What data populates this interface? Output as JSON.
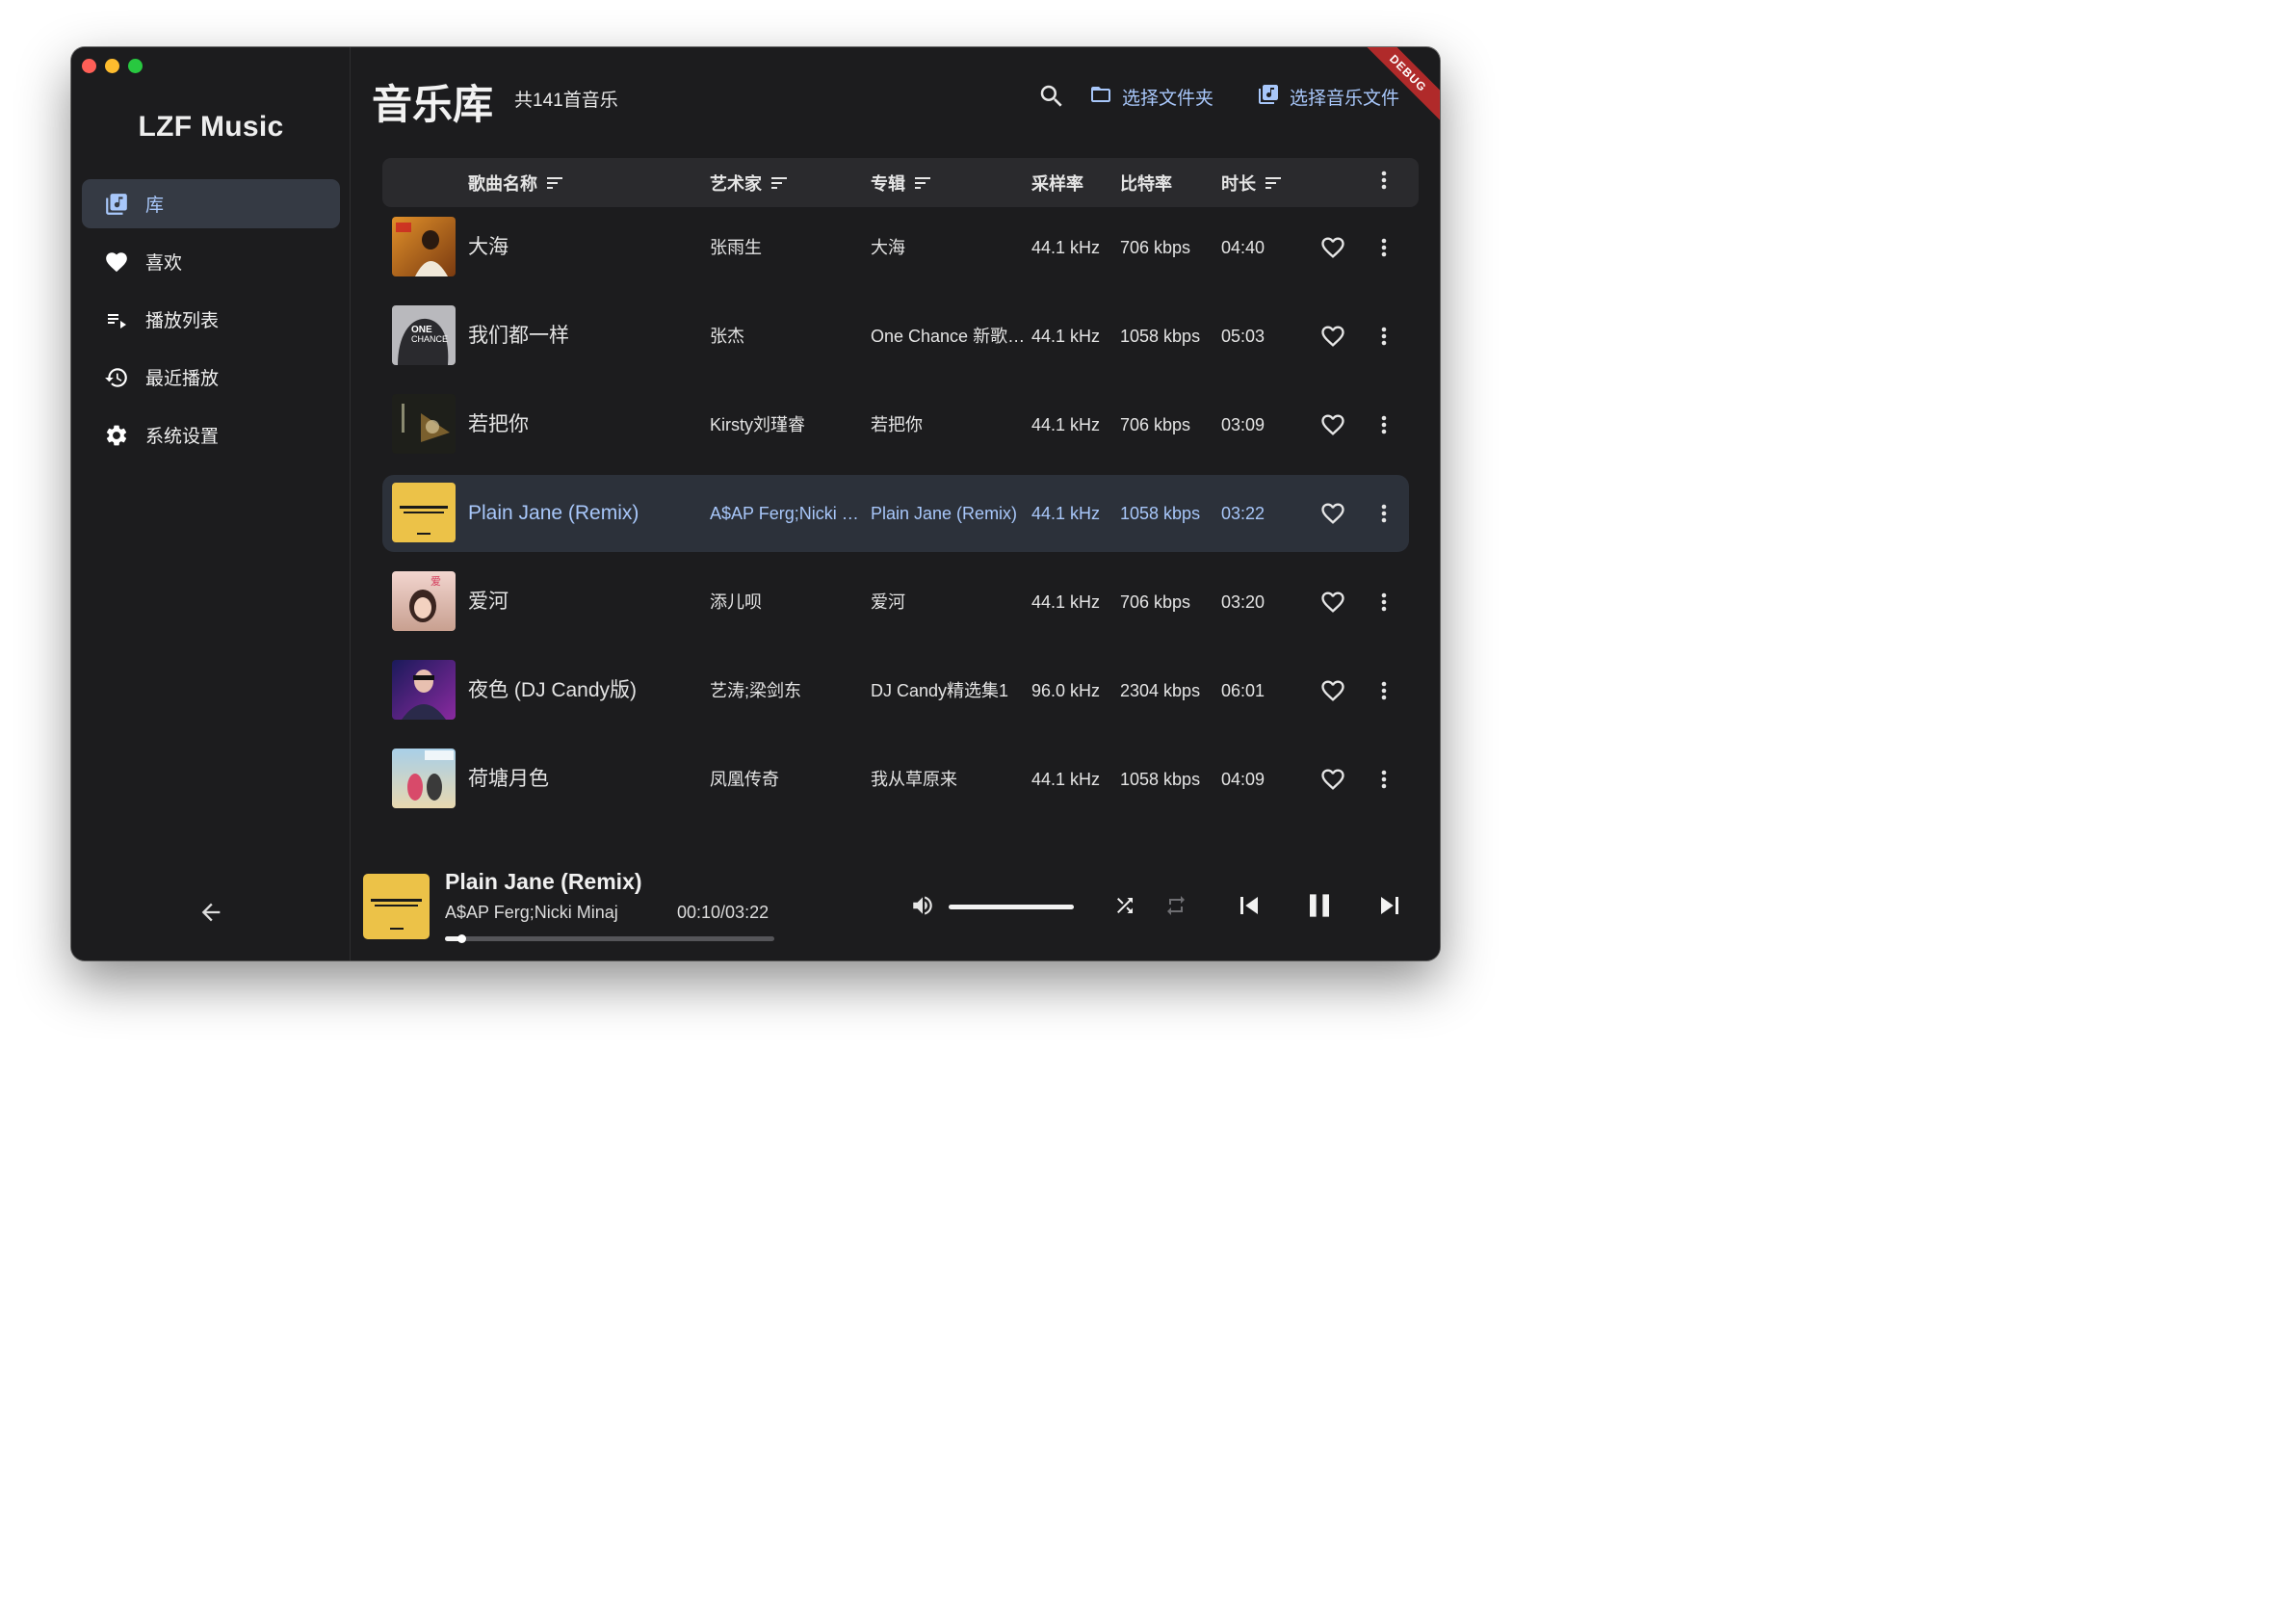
{
  "window": {
    "traffic_lights": [
      "close",
      "minimize",
      "zoom"
    ]
  },
  "sidebar": {
    "app_title": "LZF Music",
    "items": [
      {
        "label": "库",
        "icon": "library-music-icon",
        "active": true
      },
      {
        "label": "喜欢",
        "icon": "heart-filled-icon",
        "active": false
      },
      {
        "label": "播放列表",
        "icon": "playlist-icon",
        "active": false
      },
      {
        "label": "最近播放",
        "icon": "history-icon",
        "active": false
      },
      {
        "label": "系统设置",
        "icon": "gear-icon",
        "active": false
      }
    ],
    "back_icon": "arrow-left-icon"
  },
  "header": {
    "title": "音乐库",
    "count": "共141首音乐",
    "search_icon": "search-icon",
    "select_folder": "选择文件夹",
    "select_files": "选择音乐文件",
    "debug_banner": "DEBUG"
  },
  "table": {
    "columns": {
      "title": "歌曲名称",
      "artist": "艺术家",
      "album": "专辑",
      "sample_rate": "采样率",
      "bitrate": "比特率",
      "duration": "时长"
    },
    "rows": [
      {
        "title": "大海",
        "artist": "张雨生",
        "album": "大海",
        "sample_rate": "44.1 kHz",
        "bitrate": "706 kbps",
        "duration": "04:40",
        "selected": false,
        "cover": "ocean"
      },
      {
        "title": "我们都一样",
        "artist": "张杰",
        "album": "One Chance 新歌+精选",
        "sample_rate": "44.1 kHz",
        "bitrate": "1058 kbps",
        "duration": "05:03",
        "selected": false,
        "cover": "onechance"
      },
      {
        "title": "若把你",
        "artist": "Kirsty刘瑾睿",
        "album": "若把你",
        "sample_rate": "44.1 kHz",
        "bitrate": "706 kbps",
        "duration": "03:09",
        "selected": false,
        "cover": "dark"
      },
      {
        "title": "Plain Jane (Remix)",
        "artist": "A$AP Ferg;Nicki Minaj",
        "album": "Plain Jane (Remix)",
        "sample_rate": "44.1 kHz",
        "bitrate": "1058 kbps",
        "duration": "03:22",
        "selected": true,
        "cover": "plainjane"
      },
      {
        "title": "爱河",
        "artist": "添儿呗",
        "album": "爱河",
        "sample_rate": "44.1 kHz",
        "bitrate": "706 kbps",
        "duration": "03:20",
        "selected": false,
        "cover": "pink"
      },
      {
        "title": "夜色 (DJ Candy版)",
        "artist": "艺涛;梁剑东",
        "album": "DJ Candy精选集1",
        "sample_rate": "96.0 kHz",
        "bitrate": "2304 kbps",
        "duration": "06:01",
        "selected": false,
        "cover": "purple"
      },
      {
        "title": "荷塘月色",
        "artist": "凤凰传奇",
        "album": "我从草原来",
        "sample_rate": "44.1 kHz",
        "bitrate": "1058 kbps",
        "duration": "04:09",
        "selected": false,
        "cover": "sky"
      }
    ]
  },
  "player": {
    "title": "Plain Jane (Remix)",
    "artist": "A$AP Ferg;Nicki Minaj",
    "time": "00:10/03:22",
    "progress": 0.05,
    "volume": 1.0,
    "icons": [
      "volume-icon",
      "shuffle-icon",
      "repeat-icon",
      "skip-previous-icon",
      "pause-icon",
      "skip-next-icon"
    ]
  },
  "colors": {
    "accent": "#a8c7fa",
    "background": "#1c1c1e",
    "selected_row": "#2c313a",
    "header_bar": "#2a2a2d",
    "active_nav": "#353a44"
  }
}
